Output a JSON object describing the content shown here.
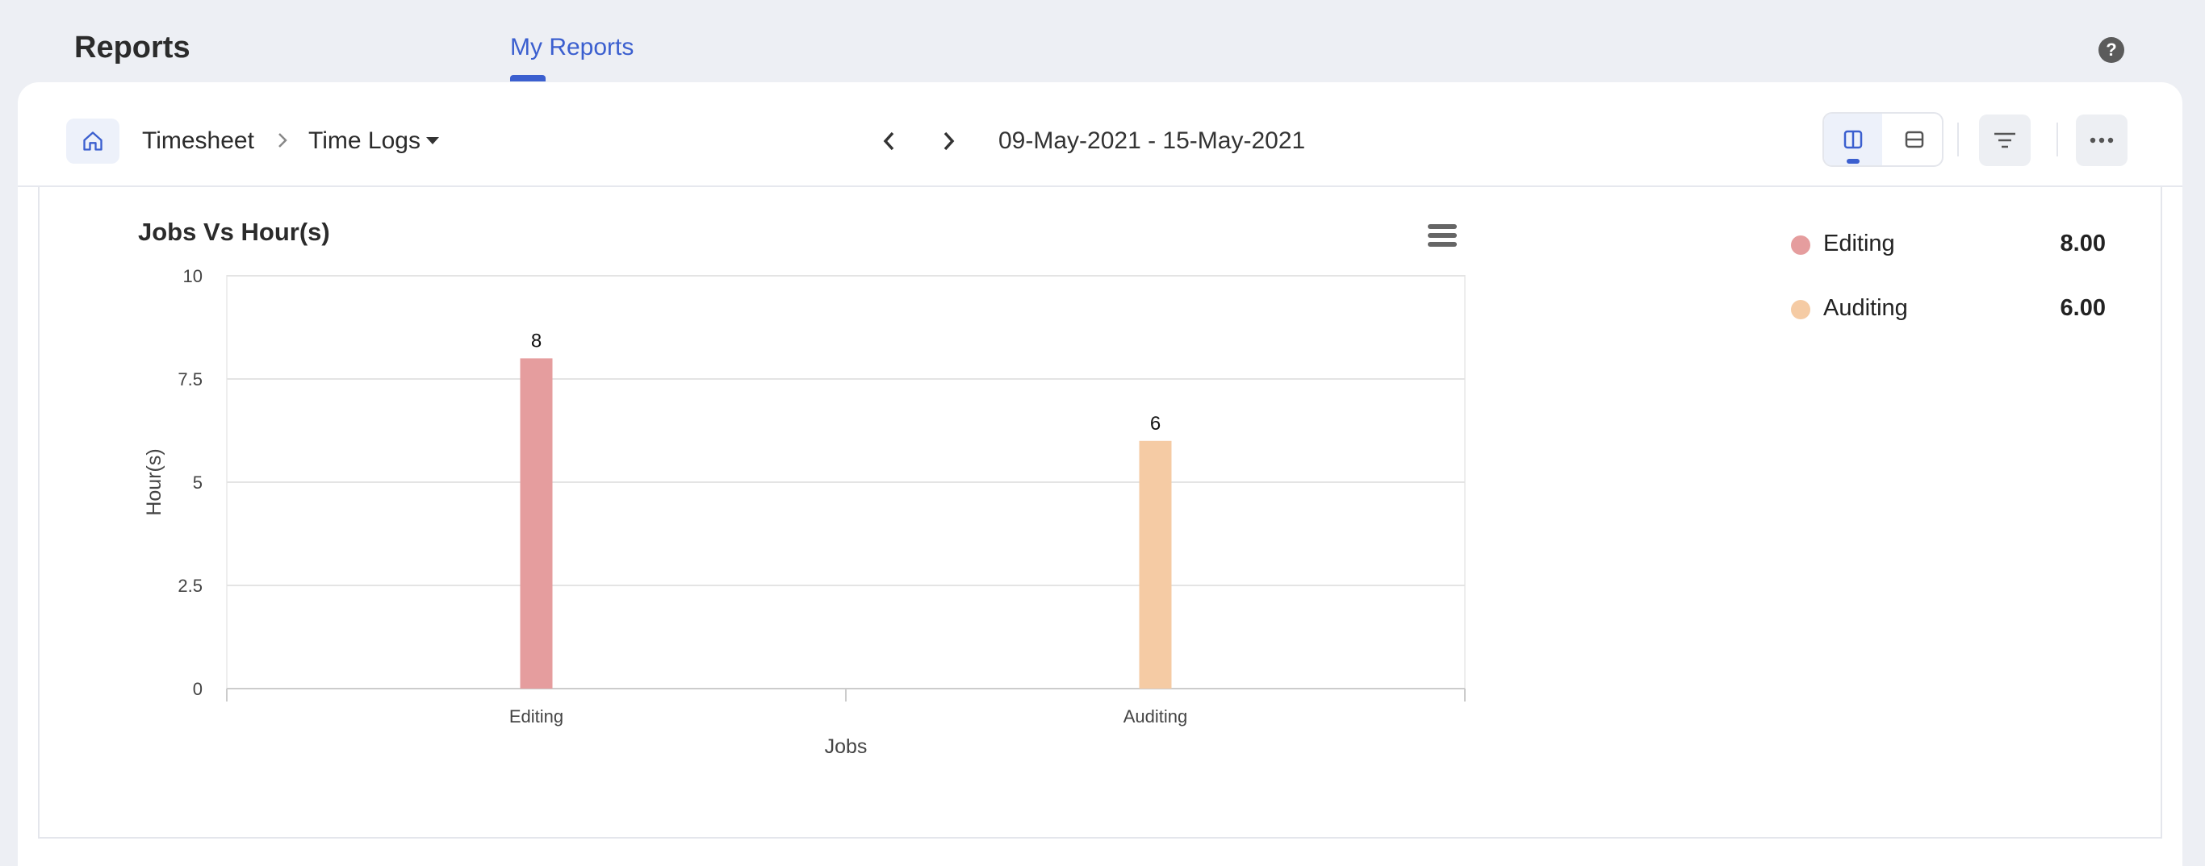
{
  "header": {
    "app_title": "Reports",
    "active_tab": "My Reports",
    "help_label": "?"
  },
  "toolbar": {
    "breadcrumb": [
      "Timesheet",
      "Time Logs"
    ],
    "date_range": "09-May-2021 - 15-May-2021",
    "icons": [
      "home-icon",
      "chevron-right-icon",
      "caret-down-icon",
      "chevron-left-icon",
      "chevron-right-icon",
      "split-vertical-icon",
      "split-horizontal-icon",
      "filter-icon",
      "more-icon"
    ]
  },
  "chart": {
    "menu_icon": "hamburger-menu-icon"
  },
  "chart_data": {
    "type": "bar",
    "title": "Jobs Vs Hour(s)",
    "xlabel": "Jobs",
    "ylabel": "Hour(s)",
    "categories": [
      "Editing",
      "Auditing"
    ],
    "values": [
      8,
      6
    ],
    "value_labels": [
      "8",
      "6"
    ],
    "colors": [
      "#e59d9e",
      "#f5cba4"
    ],
    "ylim": [
      0,
      10
    ],
    "yticks": [
      0,
      2.5,
      5,
      7.5,
      10
    ],
    "ytick_labels": [
      "0",
      "2.5",
      "5",
      "7.5",
      "10"
    ],
    "grid": true,
    "legend_position": "right"
  },
  "legend": {
    "items": [
      {
        "label": "Editing",
        "value": "8.00",
        "color": "#e59d9e"
      },
      {
        "label": "Auditing",
        "value": "6.00",
        "color": "#f5cba4"
      }
    ]
  }
}
